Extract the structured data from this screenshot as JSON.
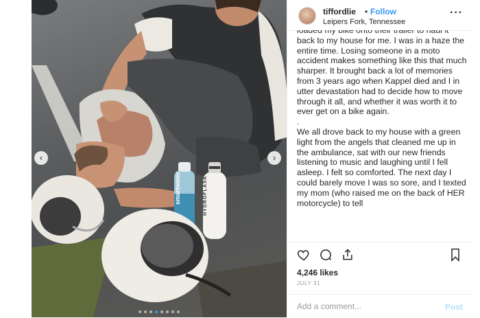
{
  "post": {
    "username": "tiffordlie",
    "separator": "•",
    "follow_label": "Follow",
    "location": "Leipers Fork, Tennessee",
    "more_icon": "more-options-icon",
    "caption_paragraphs": [
      "loaded my bike onto their trailer to haul it back to my house for me. I was in a haze the entire time. Losing someone in a moto accident makes something like this that much sharper. It brought back a lot of memories from 3 years ago when Kappel died and I in utter devastation had to decide how to move through it all, and whether it was worth it to ever get on a bike again.",
      ".",
      "We all drove back to my house with a green light from the angels that cleaned me up in the ambulance, sat with our new friends listening to music and laughing until I fell asleep. I felt so comforted. The next day I could barely move I was so sore, and I texted my mom (who raised me on the back of HER motorcycle) to tell"
    ],
    "likes": "4,246 likes",
    "date": "JULY 31",
    "comment_placeholder": "Add a comment...",
    "post_label": "Post"
  },
  "photo": {
    "bottle_brand": "smartwater",
    "bottle2_brand": "HYDROFLASK",
    "carousel_dots": 8,
    "active_dot": 3
  },
  "icons": {
    "like": "heart-icon",
    "comment": "comment-icon",
    "share": "share-icon",
    "save": "bookmark-icon",
    "prev": "chevron-left-icon",
    "next": "chevron-right-icon"
  },
  "colors": {
    "follow": "#3897f0",
    "post_disabled": "#b2dffc",
    "text": "#262626",
    "muted": "#999999"
  }
}
